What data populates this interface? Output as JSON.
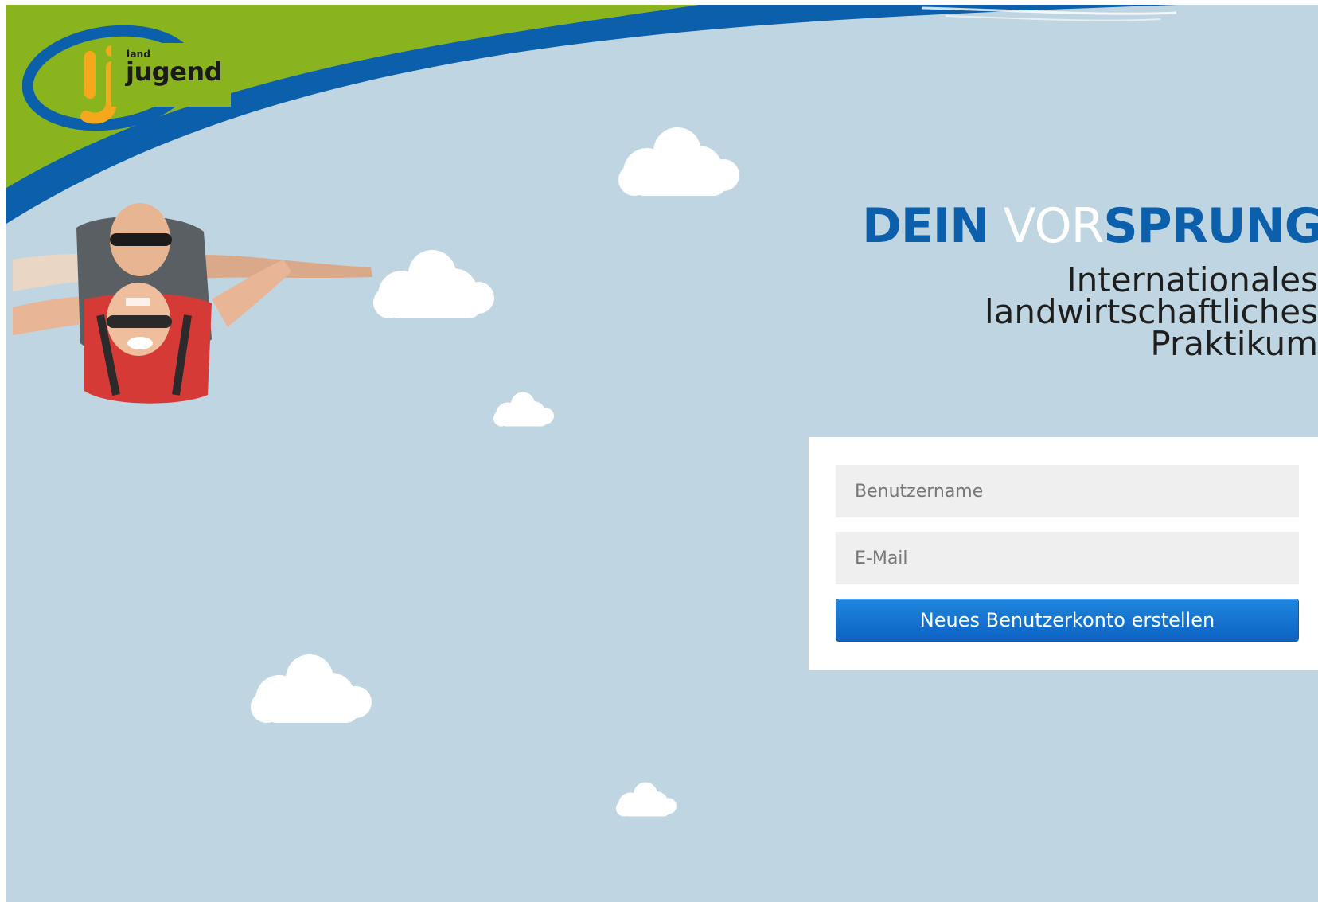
{
  "brand": {
    "logo_small": "land",
    "logo_big": "jugend"
  },
  "hero": {
    "headline": {
      "part1": "DEIN",
      "part2": " VOR",
      "part3": "SPRUNG"
    },
    "subline": [
      "Internationales",
      "landwirtschaftliches",
      "Praktikum"
    ]
  },
  "form": {
    "username_placeholder": "Benutzername",
    "email_placeholder": "E-Mail",
    "submit_label": "Neues Benutzerkonto erstellen"
  },
  "colors": {
    "sky": "#bfd5e2",
    "green_band": "#8ab41d",
    "blue_band": "#0b5fab",
    "headline_blue": "#0b5fab",
    "button": "#1478d4"
  },
  "icons": {
    "logo": "landjugend-logo",
    "clouds": "cloud-icon",
    "photo": "skydivers-photo"
  }
}
